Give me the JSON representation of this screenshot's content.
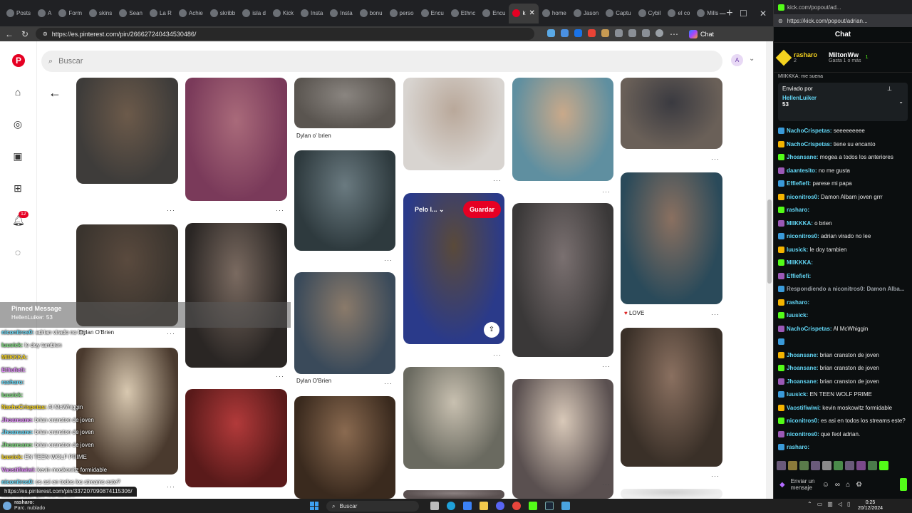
{
  "browser": {
    "tabs": [
      {
        "label": "Posts"
      },
      {
        "label": "A"
      },
      {
        "label": "Form"
      },
      {
        "label": "skins"
      },
      {
        "label": "Sean"
      },
      {
        "label": "La R"
      },
      {
        "label": "Achie"
      },
      {
        "label": "skribb"
      },
      {
        "label": "isla d"
      },
      {
        "label": "Kick"
      },
      {
        "label": "Insta"
      },
      {
        "label": "Insta"
      },
      {
        "label": "bonu"
      },
      {
        "label": "perso"
      },
      {
        "label": "Encu"
      },
      {
        "label": "Ethnc"
      },
      {
        "label": "Encu"
      },
      {
        "label": "k",
        "active": true
      },
      {
        "label": "home"
      },
      {
        "label": "Jason"
      },
      {
        "label": "Captu"
      },
      {
        "label": "Cybil"
      },
      {
        "label": "el co"
      },
      {
        "label": "Mills"
      }
    ],
    "new_tab": "+",
    "url": "https://es.pinterest.com/pin/266627240434530486/",
    "chat_button": "Chat",
    "status_url": "https://es.pinterest.com/pin/337207090874115306/"
  },
  "pinterest": {
    "search_placeholder": "Buscar",
    "account_initial": "A",
    "notification_count": "12",
    "hover_board": "Pelo l...",
    "save_label": "Guardar",
    "captions": {
      "c1": "Dylan o' brien",
      "c2": "Dylan O'Brien",
      "c3": "Dylan O'Brien",
      "c4": "LOVE"
    }
  },
  "overlay": {
    "pinned_title": "Pinned Message",
    "pinned_user": "HellenLuiker",
    "pinned_value": "53",
    "lines": [
      {
        "user": "niconitros0:",
        "text": "adrian virado no lee"
      },
      {
        "user": "luusick:",
        "text": "le doy tambien"
      },
      {
        "user": "MIIKKKA:",
        "text": ""
      },
      {
        "user": "Effiefiefi:",
        "text": ""
      },
      {
        "user": "rasharo:",
        "text": ""
      },
      {
        "user": "luusick:",
        "text": ""
      },
      {
        "user": "NachoCrispetas:",
        "text": "Al McWhiggin"
      },
      {
        "user": "Jhoansane:",
        "text": "brian cranston de joven"
      },
      {
        "user": "Jhoansane:",
        "text": "brian cranston de joven"
      },
      {
        "user": "Jhoansane:",
        "text": "brian cranston de joven"
      },
      {
        "user": "luusick:",
        "text": "EN TEEN WOLF PRIME"
      },
      {
        "user": "Vaostifiwiwi:",
        "text": "kevin moskowitz formidable"
      },
      {
        "user": "niconitros0:",
        "text": "es asi en todos los streams este?"
      },
      {
        "user": "niconitros0:",
        "text": "que feol adrian."
      }
    ],
    "bottom_user": "rasharo:"
  },
  "kick": {
    "window_url_short": "kick.com/popout/ad...",
    "url": "https://kick.com/popout/adrian...",
    "chat_title": "Chat",
    "top_user_1": "rasharo",
    "top_user_1_count": "2",
    "top_user_2": "MiltonWw",
    "top_user_2_count": "1",
    "gift_text": "Gasta 1",
    "gift_more": "o más",
    "partial_msg": "MIIKKKA: me suena",
    "pinned_by": "Enviado por",
    "pinned_user": "HellenLuiker",
    "pinned_value": "53",
    "messages": [
      {
        "user": "NachoCrispetas:",
        "text": "seeeeeeeee",
        "color": "#62d6f5"
      },
      {
        "user": "NachoCrispetas:",
        "text": "tiene su encanto",
        "color": "#62d6f5"
      },
      {
        "user": "Jhoansane:",
        "text": "mogea a todos los anteriores",
        "color": "#62d6f5"
      },
      {
        "user": "daantesito:",
        "text": "no me gusta",
        "color": "#62d6f5"
      },
      {
        "user": "Effiefiefi:",
        "text": "parese mi papa",
        "color": "#62d6f5"
      },
      {
        "user": "niconitros0:",
        "text": "Damon Albarn joven grrr",
        "color": "#62d6f5"
      },
      {
        "user": "rasharo:",
        "text": "",
        "color": "#62d6f5"
      },
      {
        "user": "MIIKKKA:",
        "text": "o brien",
        "color": "#62d6f5"
      },
      {
        "user": "niconitros0:",
        "text": "adrian virado no lee",
        "color": "#62d6f5"
      },
      {
        "user": "luusick:",
        "text": "le doy tambien",
        "color": "#62d6f5"
      },
      {
        "user": "MIIKKKA:",
        "text": "",
        "color": "#62d6f5"
      },
      {
        "user": "Effiefiefi:",
        "text": "",
        "color": "#62d6f5"
      },
      {
        "user": "Respondiendo a niconitros0: Damon Alba...",
        "text": "",
        "color": "#9aa0a6"
      },
      {
        "user": "rasharo:",
        "text": "",
        "color": "#62d6f5"
      },
      {
        "user": "luusick:",
        "text": "",
        "color": "#62d6f5"
      },
      {
        "user": "NachoCrispetas:",
        "text": "Al McWhiggin",
        "color": "#62d6f5"
      },
      {
        "user": "",
        "text": "",
        "color": "#62d6f5"
      },
      {
        "user": "Jhoansane:",
        "text": "brian cranston de joven",
        "color": "#62d6f5"
      },
      {
        "user": "Jhoansane:",
        "text": "brian cranston de joven",
        "color": "#62d6f5"
      },
      {
        "user": "Jhoansane:",
        "text": "brian cranston de joven",
        "color": "#62d6f5"
      },
      {
        "user": "luusick:",
        "text": "EN TEEN WOLF PRIME",
        "color": "#62d6f5"
      },
      {
        "user": "Vaostifiwiwi:",
        "text": "kevin moskowitz formidable",
        "color": "#62d6f5"
      },
      {
        "user": "niconitros0:",
        "text": "es asi en todos los streams este?",
        "color": "#62d6f5"
      },
      {
        "user": "niconitros0:",
        "text": "que feol adrian.",
        "color": "#62d6f5"
      },
      {
        "user": "rasharo:",
        "text": "",
        "color": "#62d6f5"
      }
    ],
    "input_placeholder": "Enviar un mensaje"
  },
  "taskbar": {
    "weather_name": "rasharo:",
    "weather_desc": "Parc. nublado",
    "search_label": "Buscar",
    "time": "0:25",
    "date": "20/12/2024"
  }
}
